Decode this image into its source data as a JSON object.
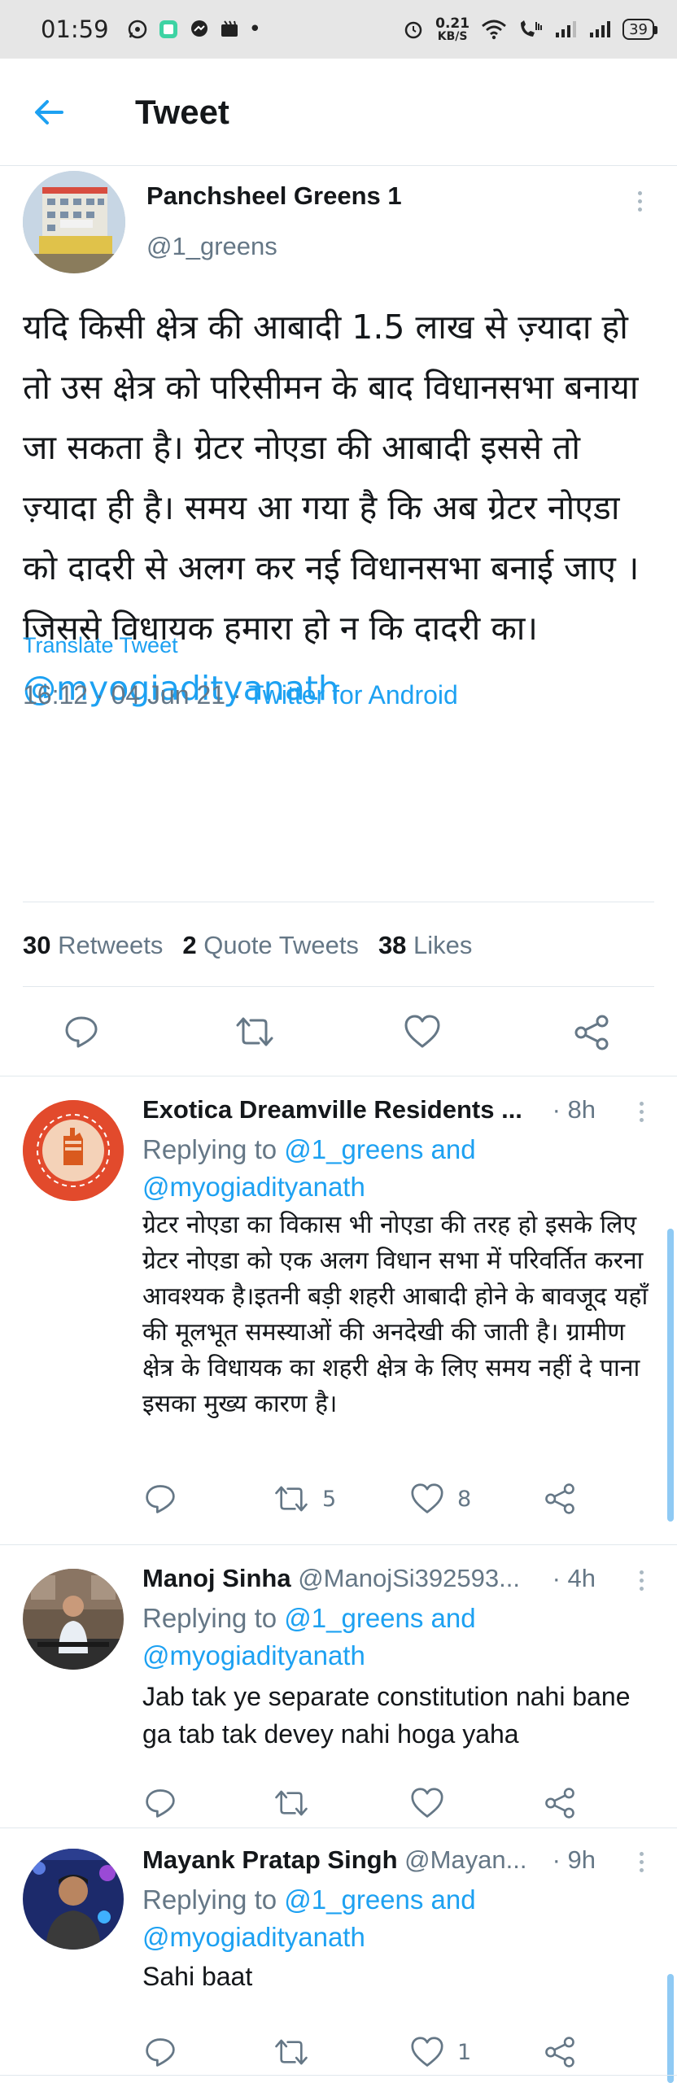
{
  "status_bar": {
    "time": "01:59",
    "net_speed_value": "0.21",
    "net_speed_unit": "KB/S",
    "battery": "39"
  },
  "app_bar": {
    "title": "Tweet"
  },
  "tweet": {
    "author_name": "Panchsheel Greens 1",
    "author_handle": "@1_greens",
    "text": "यदि किसी क्षेत्र की आबादी 1.5 लाख से ज़्यादा हो तो उस क्षेत्र को परिसीमन के बाद विधानसभा बनाया जा सकता है। ग्रेटर नोएडा की आबादी इससे तो ज़्यादा ही है। समय आ गया है कि अब ग्रेटर नोएडा को दादरी से अलग कर नई विधानसभा बनाई जाए । जिससे विधायक हमारा हो न कि दादरी का। ",
    "mention": "@myogiadityanath",
    "translate_label": "Translate Tweet",
    "timestamp": "16:12 · 04 Jun 21 · ",
    "client": "Twitter for Android",
    "stats": {
      "retweets_count": "30",
      "retweets_label": "Retweets",
      "quotes_count": "2",
      "quotes_label": "Quote Tweets",
      "likes_count": "38",
      "likes_label": "Likes"
    }
  },
  "replies": [
    {
      "name": "Exotica Dreamville Residents ...",
      "handle": "",
      "time": "· 8h",
      "replying_prefix": "Replying to ",
      "replying_mention1": "@1_greens and",
      "replying_mention2": "@myogiadityanath",
      "text": "ग्रेटर नोएडा का विकास भी नोएडा की तरह हो इसके लिए ग्रेटर नोएडा को एक अलग विधान सभा में परिवर्तित करना आवश्यक है।इतनी बड़ी शहरी आबादी होने के बावजूद यहाँ की मूलभूत समस्याओं की अनदेखी की जाती है। ग्रामीण क्षेत्र के विधायक का शहरी क्षेत्र के लिए समय नहीं दे पाना इसका मुख्य कारण है।",
      "retweets": "5",
      "likes": "8",
      "avatar_text": "EXOTICA DREAMVILLE RESIDENTS"
    },
    {
      "name": "Manoj Sinha",
      "handle": " @ManojSi392593...",
      "time": "· 4h",
      "replying_prefix": "Replying to ",
      "replying_mention1": "@1_greens and",
      "replying_mention2": "@myogiadityanath",
      "text": "Jab tak ye separate constitution nahi bane ga tab tak devey nahi hoga yaha",
      "retweets": "",
      "likes": ""
    },
    {
      "name": "Mayank Pratap Singh",
      "handle": " @Mayan...",
      "time": "· 9h",
      "replying_prefix": "Replying to ",
      "replying_mention1": "@1_greens and",
      "replying_mention2": "@myogiadityanath",
      "text": "Sahi baat",
      "retweets": "",
      "likes": "1"
    }
  ],
  "colors": {
    "accent": "#1da1f2",
    "secondary_text": "#657786",
    "divider": "#e1e8ed"
  }
}
